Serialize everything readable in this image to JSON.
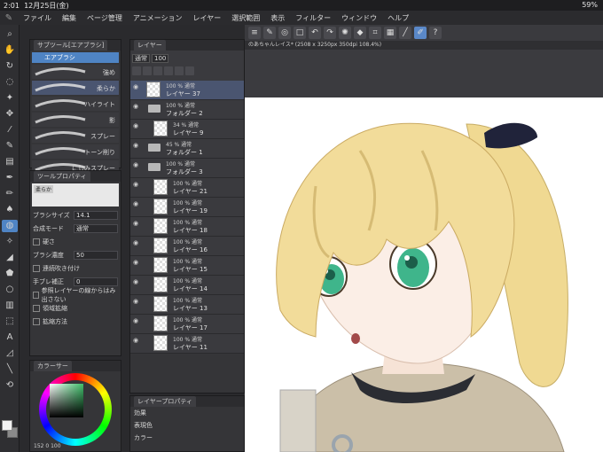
{
  "status": {
    "time": "2:01",
    "date": "12月25日(金)",
    "battery": "59%"
  },
  "menu": [
    "ファイル",
    "編集",
    "ページ管理",
    "アニメーション",
    "レイヤー",
    "選択範囲",
    "表示",
    "フィルター",
    "ウィンドウ",
    "ヘルプ"
  ],
  "subtool": {
    "title": "サブツール[エアブラシ]",
    "selected": "エアブラシ",
    "brushes": [
      "強め",
      "柔らか",
      "ハイライト",
      "影",
      "スプレー",
      "トーン削り",
      "にじみスプレー"
    ]
  },
  "toolprop": {
    "title": "ツールプロパティ",
    "preview_label": "柔らか",
    "rows": [
      {
        "k": "ブラシサイズ",
        "v": "14.1"
      },
      {
        "k": "合成モード",
        "v": "通常"
      },
      {
        "k": "硬さ",
        "v": ""
      },
      {
        "k": "ブラシ濃度",
        "v": "50"
      },
      {
        "k": "連続吹き付け",
        "v": ""
      },
      {
        "k": "手ブレ補正",
        "v": "0"
      },
      {
        "k": "参照レイヤーの線からはみ出さない",
        "v": ""
      },
      {
        "k": "領域拡縮",
        "v": ""
      },
      {
        "k": "拡縮方法",
        "v": ""
      }
    ]
  },
  "colorcircle": {
    "title": "カラーサー",
    "hsv": "152 0 100"
  },
  "layers": {
    "title": "レイヤー",
    "blend": "通常",
    "opacity": "100",
    "items": [
      {
        "op": "100 % 通常",
        "nm": "レイヤー 37",
        "type": "layer",
        "indent": 0,
        "sel": true,
        "tall": true
      },
      {
        "op": "100 % 通常",
        "nm": "フォルダー 2",
        "type": "folder",
        "indent": 0,
        "tall": true
      },
      {
        "op": "34 % 通常",
        "nm": "レイヤー 9",
        "type": "layer",
        "indent": 1,
        "tall": true
      },
      {
        "op": "45 % 通常",
        "nm": "フォルダー 1",
        "type": "folder",
        "indent": 0,
        "tall": true
      },
      {
        "op": "100 % 通常",
        "nm": "フォルダー 3",
        "type": "folder",
        "indent": 0,
        "tall": true
      },
      {
        "op": "100 % 通常",
        "nm": "レイヤー 21",
        "type": "layer",
        "indent": 1,
        "tall": true
      },
      {
        "op": "100 % 通常",
        "nm": "レイヤー 19",
        "type": "layer",
        "indent": 1,
        "tall": true
      },
      {
        "op": "100 % 通常",
        "nm": "レイヤー 18",
        "type": "layer",
        "indent": 1,
        "tall": true
      },
      {
        "op": "100 % 通常",
        "nm": "レイヤー 16",
        "type": "layer",
        "indent": 1,
        "tall": true
      },
      {
        "op": "100 % 通常",
        "nm": "レイヤー 15",
        "type": "layer",
        "indent": 1,
        "tall": true
      },
      {
        "op": "100 % 通常",
        "nm": "レイヤー 14",
        "type": "layer",
        "indent": 1,
        "tall": true
      },
      {
        "op": "100 % 通常",
        "nm": "レイヤー 13",
        "type": "layer",
        "indent": 1,
        "tall": true
      },
      {
        "op": "100 % 通常",
        "nm": "レイヤー 17",
        "type": "layer",
        "indent": 1,
        "tall": true
      },
      {
        "op": "100 % 通常",
        "nm": "レイヤー 11",
        "type": "layer",
        "indent": 1,
        "tall": true
      }
    ]
  },
  "layerprop": {
    "title": "レイヤープロパティ",
    "effect": "効果",
    "color_label": "表現色",
    "color_value": "カラー"
  },
  "canvas": {
    "title": "のあちゃんレイス* (2508 x 3250px 350dpi 108.4%)"
  },
  "colors": {
    "accent": "#4f84c4",
    "panel": "#353538",
    "bg": "#2a2a2d"
  }
}
